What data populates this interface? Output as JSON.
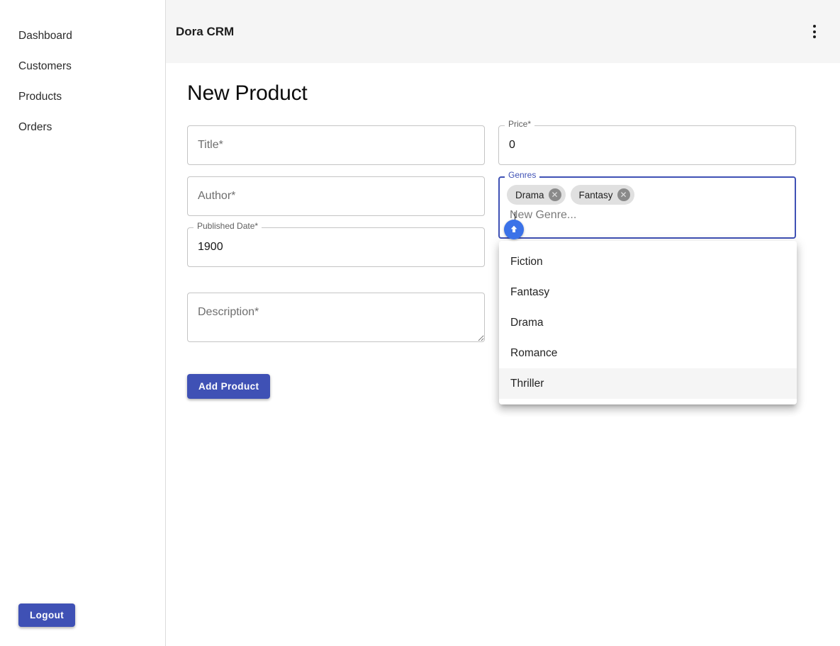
{
  "sidebar": {
    "items": [
      {
        "label": "Dashboard"
      },
      {
        "label": "Customers"
      },
      {
        "label": "Products"
      },
      {
        "label": "Orders"
      }
    ],
    "logout_label": "Logout"
  },
  "appbar": {
    "title": "Dora CRM",
    "menu_icon": "more-vert-icon"
  },
  "page": {
    "title": "New Product"
  },
  "form": {
    "title_field": {
      "placeholder": "Title*",
      "value": ""
    },
    "author_field": {
      "placeholder": "Author*",
      "value": ""
    },
    "published_date_field": {
      "label": "Published Date*",
      "value": "1900"
    },
    "description_field": {
      "placeholder": "Description*",
      "value": ""
    },
    "price_field": {
      "label": "Price*",
      "value": "0"
    },
    "genres_field": {
      "label": "Genres",
      "placeholder": "New Genre...",
      "value": "",
      "chips": [
        {
          "label": "Drama",
          "remove_icon": "cancel-icon"
        },
        {
          "label": "Fantasy",
          "remove_icon": "cancel-icon"
        }
      ]
    },
    "submit_label": "Add Product"
  },
  "genre_dropdown": {
    "options": [
      {
        "label": "Fiction",
        "highlighted": false
      },
      {
        "label": "Fantasy",
        "highlighted": false
      },
      {
        "label": "Drama",
        "highlighted": false
      },
      {
        "label": "Romance",
        "highlighted": false
      },
      {
        "label": "Thriller",
        "highlighted": true
      }
    ]
  },
  "cursor": {
    "icon": "cursor-arrow-up-icon"
  },
  "colors": {
    "accent": "#3f51b5",
    "appbar_bg": "#f5f5f5",
    "chip_bg": "#e0e0e0",
    "cursor_badge": "#3b72e8",
    "highlight_bg": "#f5f5f5"
  }
}
